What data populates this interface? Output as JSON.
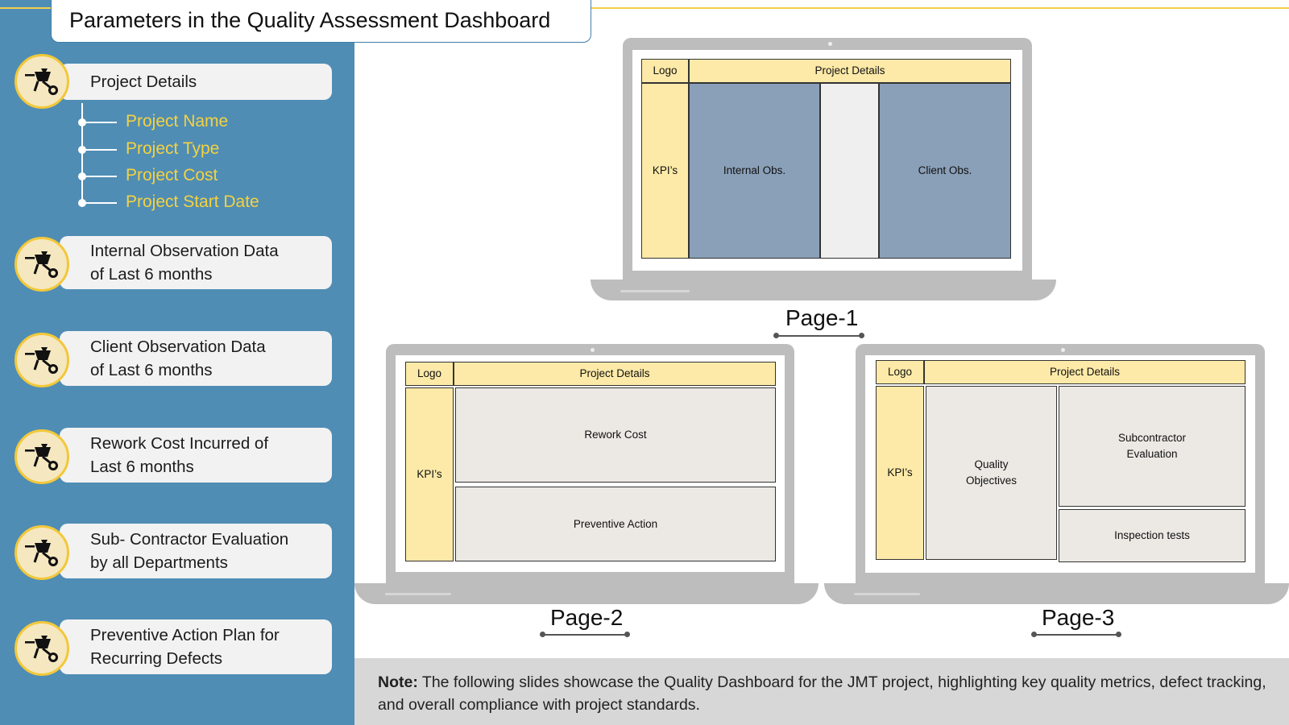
{
  "title": "Parameters in the Quality Assessment Dashboard",
  "sidebar": {
    "items": [
      {
        "label": "Project Details"
      },
      {
        "label": "Internal Observation Data\nof Last 6 months"
      },
      {
        "label": "Client Observation Data\nof Last 6 months"
      },
      {
        "label": "Rework Cost Incurred of\nLast 6 months"
      },
      {
        "label": "Sub- Contractor Evaluation\nby all Departments"
      },
      {
        "label": "Preventive Action Plan for\nRecurring Defects"
      }
    ],
    "subitems": [
      "Project Name",
      "Project Type",
      "Project Cost",
      "Project Start Date"
    ],
    "icon": "wheelbarrow-icon"
  },
  "pages": {
    "page1": {
      "label": "Page-1",
      "logo": "Logo",
      "header": "Project Details",
      "kpis": "KPI’s",
      "internal": "Internal Obs.",
      "client": "Client Obs."
    },
    "page2": {
      "label": "Page-2",
      "logo": "Logo",
      "header": "Project Details",
      "kpis": "KPI’s",
      "rework": "Rework Cost",
      "preventive": "Preventive Action"
    },
    "page3": {
      "label": "Page-3",
      "logo": "Logo",
      "header": "Project Details",
      "kpis": "KPI’s",
      "quality": "Quality\nObjectives",
      "subcontractor": "Subcontractor\nEvaluation",
      "inspection": "Inspection tests"
    }
  },
  "note": {
    "label": "Note:",
    "text": "The following slides showcase the Quality Dashboard for the JMT project, highlighting key quality metrics, defect tracking, and overall compliance with project standards."
  },
  "colors": {
    "sidebar": "#4f8db5",
    "accent_yellow": "#f2c83a",
    "cell_yellow": "#fdeaa8",
    "cell_blue": "#8aa0b8"
  }
}
